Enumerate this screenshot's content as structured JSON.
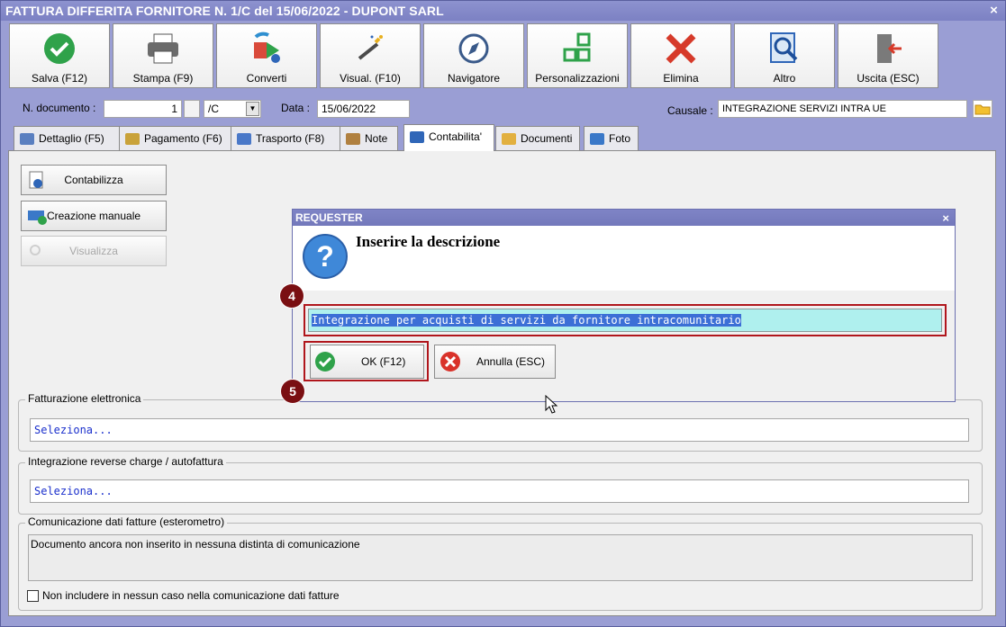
{
  "window": {
    "title": "FATTURA DIFFERITA FORNITORE N. 1/C del 15/06/2022 - DUPONT SARL",
    "close": "×"
  },
  "toolbar": [
    {
      "label": "Salva (F12)",
      "icon": "save-check-icon"
    },
    {
      "label": "Stampa (F9)",
      "icon": "printer-icon"
    },
    {
      "label": "Converti",
      "icon": "convert-icon"
    },
    {
      "label": "Visual. (F10)",
      "icon": "magic-wand-icon"
    },
    {
      "label": "Navigatore",
      "icon": "compass-icon"
    },
    {
      "label": "Personalizzazioni",
      "icon": "grid-icon"
    },
    {
      "label": "Elimina",
      "icon": "delete-x-icon"
    },
    {
      "label": "Altro",
      "icon": "magnifier-icon"
    },
    {
      "label": "Uscita (ESC)",
      "icon": "exit-door-icon"
    }
  ],
  "doc": {
    "number_label": "N. documento :",
    "number_value": "1",
    "series_value": "/C",
    "date_label": "Data :",
    "date_value": "15/06/2022",
    "causale_label": "Causale :",
    "causale_value": "INTEGRAZIONE SERVIZI INTRA UE"
  },
  "tabs": [
    {
      "label": "Dettaglio (F5)",
      "color": "#5a7fc0"
    },
    {
      "label": "Pagamento (F6)",
      "color": "#c9a23a"
    },
    {
      "label": "Trasporto (F8)",
      "color": "#4a78c8"
    },
    {
      "label": "Note",
      "color": "#b08040"
    },
    {
      "label": "Contabilita'",
      "color": "#2f66b8",
      "active": true
    },
    {
      "label": "Documenti",
      "color": "#e2b040"
    },
    {
      "label": "Foto",
      "color": "#3a78c8"
    }
  ],
  "actions": {
    "contabilizza": "Contabilizza",
    "manuale": "Creazione manuale",
    "visualizza": "Visualizza"
  },
  "groups": {
    "fe_label": "Fatturazione elettronica",
    "fe_value": "Seleziona...",
    "rc_label": "Integrazione reverse charge / autofattura",
    "rc_value": "Seleziona...",
    "com_label": "Comunicazione dati fatture (esterometro)",
    "com_text": "Documento ancora non inserito in nessuna distinta di comunicazione",
    "exclude_label": "Non includere in nessun caso nella comunicazione dati fatture"
  },
  "dialog": {
    "title": "REQUESTER",
    "close": "×",
    "message": "Inserire la descrizione",
    "input_value": "Integrazione per acquisti di servizi da fornitore intracomunitario",
    "ok": "OK (F12)",
    "cancel": "Annulla (ESC)"
  },
  "callouts": {
    "step4": "4",
    "step5": "5"
  },
  "colors": {
    "highlight": "#b0161c",
    "badge": "#7a0f12",
    "accent": "#9a9ed4"
  }
}
